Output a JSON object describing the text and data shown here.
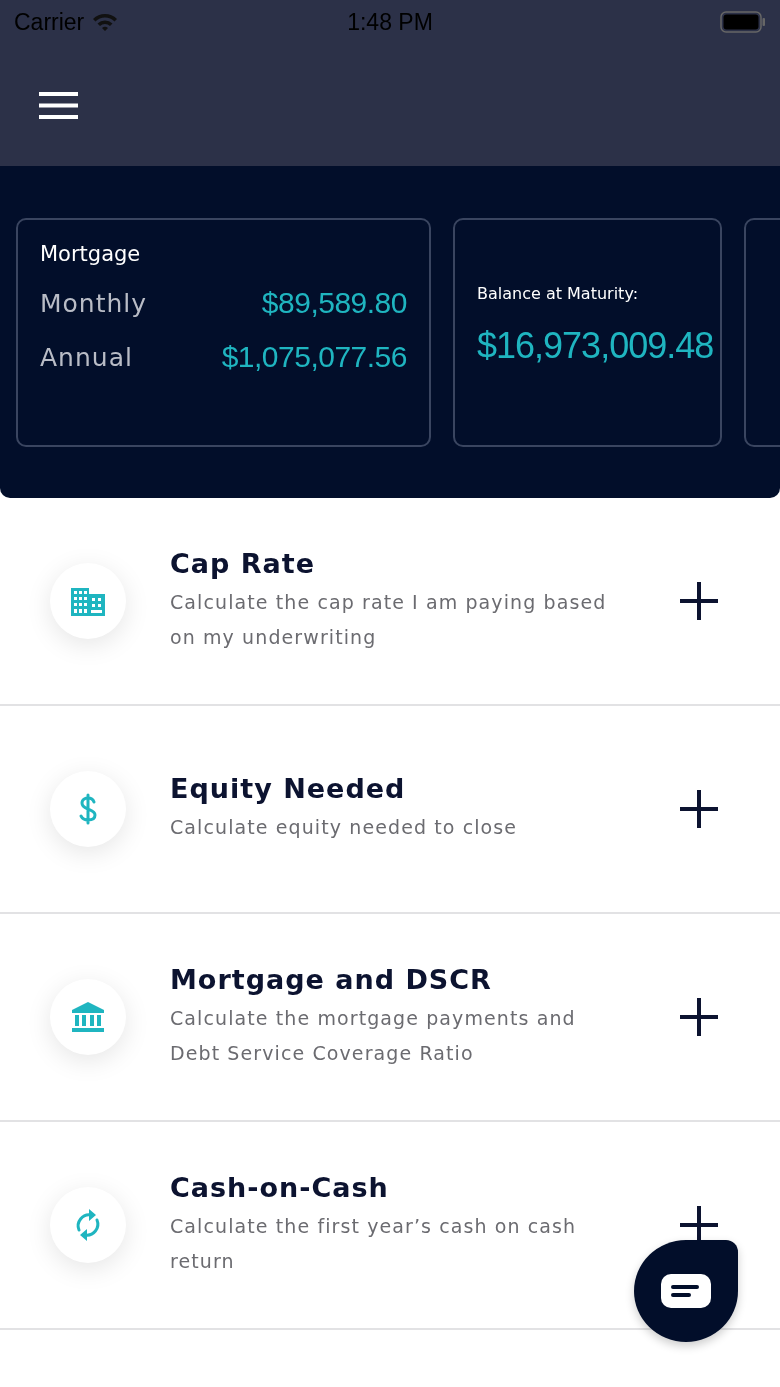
{
  "status_bar": {
    "carrier": "Carrier",
    "time": "1:48 PM"
  },
  "summary_cards": [
    {
      "kind": "mortgage",
      "title": "Mortgage",
      "lines": [
        {
          "label": "Monthly",
          "value": "$89,589.80"
        },
        {
          "label": "Annual",
          "value": "$1,075,077.56"
        }
      ]
    },
    {
      "kind": "balance",
      "title": "Balance at Maturity:",
      "value": "$16,973,009.48"
    }
  ],
  "calculators": [
    {
      "kind": "building",
      "title": "Cap Rate",
      "description": "Calculate the cap rate I am paying based on my underwriting"
    },
    {
      "kind": "dollar",
      "title": "Equity Needed",
      "description": "Calculate equity needed to close"
    },
    {
      "kind": "bank",
      "title": "Mortgage and DSCR",
      "description": "Calculate the mortgage payments and Debt Service Coverage Ratio"
    },
    {
      "kind": "refresh",
      "title": "Cash-on-Cash",
      "description": "Calculate the first year’s cash on cash return"
    }
  ]
}
